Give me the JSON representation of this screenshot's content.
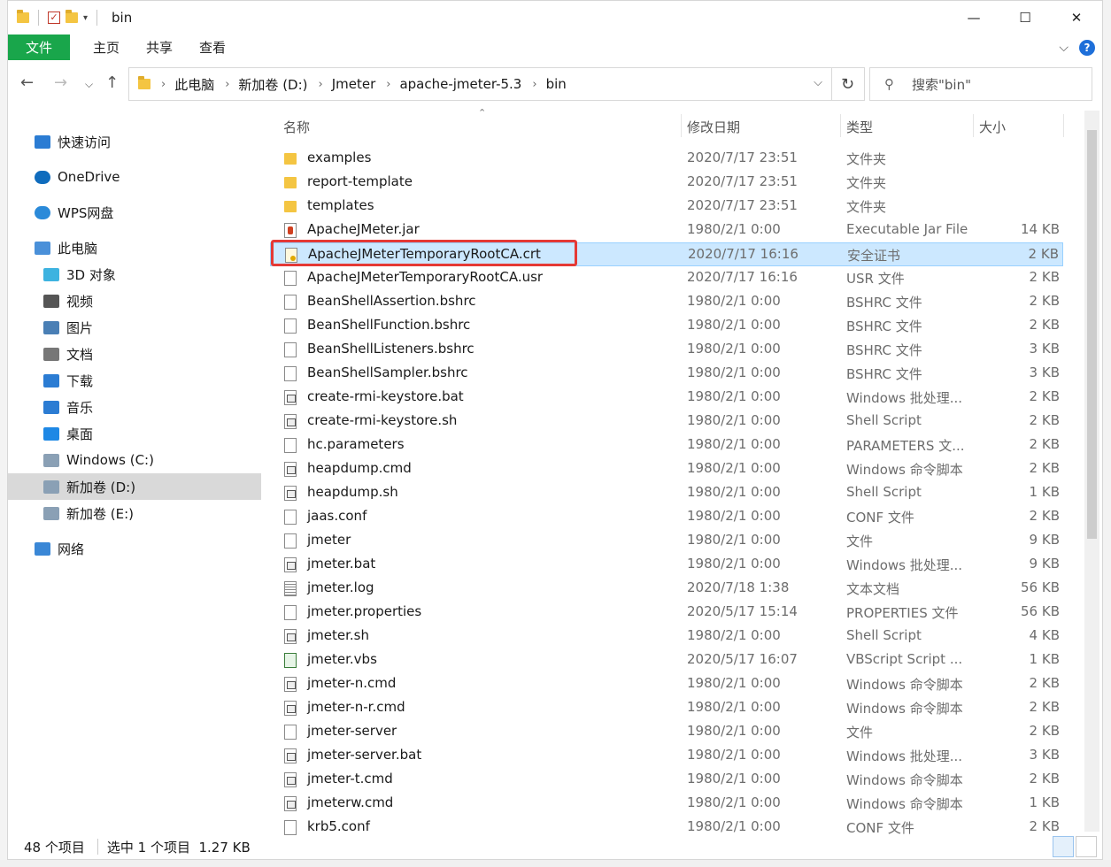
{
  "window": {
    "title": "bin",
    "caption": {
      "minimize": "—",
      "maximize": "☐",
      "close": "✕"
    }
  },
  "ribbon": {
    "tabs": [
      "文件",
      "主页",
      "共享",
      "查看"
    ]
  },
  "address": {
    "crumbs": [
      "此电脑",
      "新加卷 (D:)",
      "Jmeter",
      "apache-jmeter-5.3",
      "bin"
    ],
    "search_placeholder": "搜索\"bin\""
  },
  "nav": {
    "items": [
      {
        "label": "快速访问",
        "icon": "star-icon"
      },
      {
        "label": "OneDrive",
        "icon": "cloud-icon"
      },
      {
        "label": "WPS网盘",
        "icon": "cloud-outline-icon"
      },
      {
        "label": "此电脑",
        "icon": "computer-icon"
      },
      {
        "label": "3D 对象",
        "icon": "cube-icon"
      },
      {
        "label": "视频",
        "icon": "video-icon"
      },
      {
        "label": "图片",
        "icon": "picture-icon"
      },
      {
        "label": "文档",
        "icon": "document-icon"
      },
      {
        "label": "下载",
        "icon": "download-icon"
      },
      {
        "label": "音乐",
        "icon": "music-icon"
      },
      {
        "label": "桌面",
        "icon": "desktop-icon"
      },
      {
        "label": "Windows (C:)",
        "icon": "drive-icon"
      },
      {
        "label": "新加卷 (D:)",
        "icon": "drive-icon"
      },
      {
        "label": "新加卷 (E:)",
        "icon": "drive-icon"
      },
      {
        "label": "网络",
        "icon": "network-icon"
      }
    ],
    "selected": "新加卷 (D:)"
  },
  "columns": {
    "name": "名称",
    "date": "修改日期",
    "type": "类型",
    "size": "大小"
  },
  "files": [
    {
      "name": "examples",
      "date": "2020/7/17 23:51",
      "type": "文件夹",
      "size": "",
      "kind": "folder"
    },
    {
      "name": "report-template",
      "date": "2020/7/17 23:51",
      "type": "文件夹",
      "size": "",
      "kind": "folder"
    },
    {
      "name": "templates",
      "date": "2020/7/17 23:51",
      "type": "文件夹",
      "size": "",
      "kind": "folder"
    },
    {
      "name": "ApacheJMeter.jar",
      "date": "1980/2/1 0:00",
      "type": "Executable Jar File",
      "size": "14 KB",
      "kind": "jar"
    },
    {
      "name": "ApacheJMeterTemporaryRootCA.crt",
      "date": "2020/7/17 16:16",
      "type": "安全证书",
      "size": "2 KB",
      "kind": "cert"
    },
    {
      "name": "ApacheJMeterTemporaryRootCA.usr",
      "date": "2020/7/17 16:16",
      "type": "USR 文件",
      "size": "2 KB",
      "kind": "file"
    },
    {
      "name": "BeanShellAssertion.bshrc",
      "date": "1980/2/1 0:00",
      "type": "BSHRC 文件",
      "size": "2 KB",
      "kind": "file"
    },
    {
      "name": "BeanShellFunction.bshrc",
      "date": "1980/2/1 0:00",
      "type": "BSHRC 文件",
      "size": "2 KB",
      "kind": "file"
    },
    {
      "name": "BeanShellListeners.bshrc",
      "date": "1980/2/1 0:00",
      "type": "BSHRC 文件",
      "size": "3 KB",
      "kind": "file"
    },
    {
      "name": "BeanShellSampler.bshrc",
      "date": "1980/2/1 0:00",
      "type": "BSHRC 文件",
      "size": "3 KB",
      "kind": "file"
    },
    {
      "name": "create-rmi-keystore.bat",
      "date": "1980/2/1 0:00",
      "type": "Windows 批处理...",
      "size": "2 KB",
      "kind": "script"
    },
    {
      "name": "create-rmi-keystore.sh",
      "date": "1980/2/1 0:00",
      "type": "Shell Script",
      "size": "2 KB",
      "kind": "script"
    },
    {
      "name": "hc.parameters",
      "date": "1980/2/1 0:00",
      "type": "PARAMETERS 文...",
      "size": "2 KB",
      "kind": "file"
    },
    {
      "name": "heapdump.cmd",
      "date": "1980/2/1 0:00",
      "type": "Windows 命令脚本",
      "size": "2 KB",
      "kind": "script"
    },
    {
      "name": "heapdump.sh",
      "date": "1980/2/1 0:00",
      "type": "Shell Script",
      "size": "1 KB",
      "kind": "script"
    },
    {
      "name": "jaas.conf",
      "date": "1980/2/1 0:00",
      "type": "CONF 文件",
      "size": "2 KB",
      "kind": "file"
    },
    {
      "name": "jmeter",
      "date": "1980/2/1 0:00",
      "type": "文件",
      "size": "9 KB",
      "kind": "file"
    },
    {
      "name": "jmeter.bat",
      "date": "1980/2/1 0:00",
      "type": "Windows 批处理...",
      "size": "9 KB",
      "kind": "script"
    },
    {
      "name": "jmeter.log",
      "date": "2020/7/18 1:38",
      "type": "文本文档",
      "size": "56 KB",
      "kind": "log"
    },
    {
      "name": "jmeter.properties",
      "date": "2020/5/17 15:14",
      "type": "PROPERTIES 文件",
      "size": "56 KB",
      "kind": "file"
    },
    {
      "name": "jmeter.sh",
      "date": "1980/2/1 0:00",
      "type": "Shell Script",
      "size": "4 KB",
      "kind": "script"
    },
    {
      "name": "jmeter.vbs",
      "date": "2020/5/17 16:07",
      "type": "VBScript Script ...",
      "size": "1 KB",
      "kind": "vbs"
    },
    {
      "name": "jmeter-n.cmd",
      "date": "1980/2/1 0:00",
      "type": "Windows 命令脚本",
      "size": "2 KB",
      "kind": "script"
    },
    {
      "name": "jmeter-n-r.cmd",
      "date": "1980/2/1 0:00",
      "type": "Windows 命令脚本",
      "size": "2 KB",
      "kind": "script"
    },
    {
      "name": "jmeter-server",
      "date": "1980/2/1 0:00",
      "type": "文件",
      "size": "2 KB",
      "kind": "file"
    },
    {
      "name": "jmeter-server.bat",
      "date": "1980/2/1 0:00",
      "type": "Windows 批处理...",
      "size": "3 KB",
      "kind": "script"
    },
    {
      "name": "jmeter-t.cmd",
      "date": "1980/2/1 0:00",
      "type": "Windows 命令脚本",
      "size": "2 KB",
      "kind": "script"
    },
    {
      "name": "jmeterw.cmd",
      "date": "1980/2/1 0:00",
      "type": "Windows 命令脚本",
      "size": "1 KB",
      "kind": "script"
    },
    {
      "name": "krb5.conf",
      "date": "1980/2/1 0:00",
      "type": "CONF 文件",
      "size": "2 KB",
      "kind": "file"
    }
  ],
  "selected_file": "ApacheJMeterTemporaryRootCA.crt",
  "status": {
    "count": "48 个项目",
    "selection": "选中 1 个项目  1.27 KB"
  },
  "colors": {
    "file_tab": "#19a64b",
    "selection": "#cce8ff",
    "highlight_box": "#e53935"
  }
}
